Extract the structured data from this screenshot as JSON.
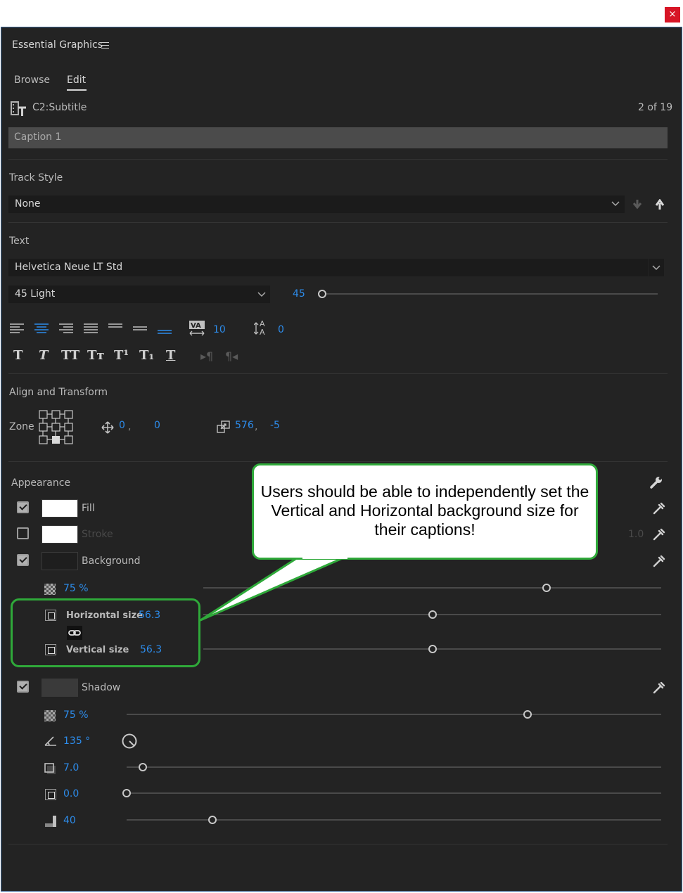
{
  "window": {
    "close_glyph": "×",
    "close_color": "#d71526"
  },
  "panel": {
    "title": "Essential Graphics",
    "menu_icon": "hamburger-icon"
  },
  "tabs": [
    {
      "label": "Browse"
    },
    {
      "label": "Edit",
      "active": true
    }
  ],
  "clip": {
    "name": "C2:Subtitle",
    "counter": "2 of 19",
    "caption_value": "Caption 1"
  },
  "track_style": {
    "heading": "Track Style",
    "selected": "None"
  },
  "text": {
    "heading": "Text",
    "font_family": "Helvetica Neue LT Std",
    "font_style": "45 Light",
    "font_size": "45",
    "font_size_level": 0.0,
    "tracking": "10",
    "leading": "0",
    "format_buttons": [
      "T",
      "T",
      "TT",
      "Tт",
      "T¹",
      "T₁",
      "T"
    ]
  },
  "align_transform": {
    "heading": "Align and Transform",
    "zone_label": "Zone",
    "position_x": "0",
    "position_sep": ",",
    "position_y": "0",
    "scale_x": "576",
    "scale_sep": ",",
    "scale_y": "-5"
  },
  "appearance": {
    "heading": "Appearance",
    "fill": {
      "label": "Fill",
      "checked": true,
      "color": "#ffffff"
    },
    "stroke": {
      "label": "Stroke",
      "checked": false,
      "color": "#ffffff",
      "width": "1.0"
    },
    "background": {
      "label": "Background",
      "checked": true,
      "color": "#1e1e1e",
      "opacity": "75 %",
      "opacity_level": 0.75,
      "horizontal_label": "Horizontal size",
      "horizontal_value": "56.3",
      "horizontal_level": 0.5,
      "vertical_label": "Vertical size",
      "vertical_value": "56.3",
      "vertical_level": 0.5
    },
    "shadow": {
      "label": "Shadow",
      "checked": true,
      "color": "#3a3a3a",
      "opacity": "75 %",
      "opacity_level": 0.75,
      "angle": "135 °",
      "distance": "7.0",
      "distance_level": 0.03,
      "size": "0.0",
      "size_level": 0.0,
      "blur": "40",
      "blur_level": 0.16
    }
  },
  "annotation": {
    "text": "Users should be able to independently set the Vertical and Horizontal background size for their captions!",
    "border_color": "#2fa93a"
  },
  "colors": {
    "panel_bg": "#232323",
    "accent_blue": "#2d8ceb",
    "label_gray": "#b9b9b9"
  }
}
